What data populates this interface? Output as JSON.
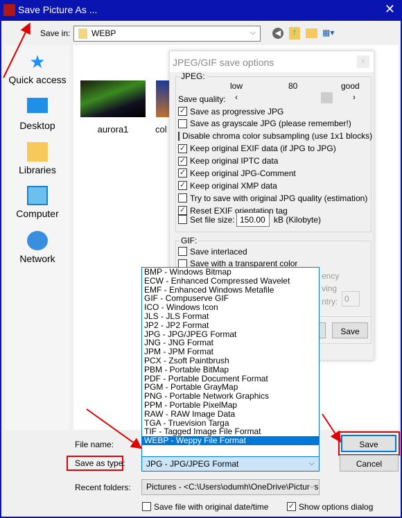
{
  "window": {
    "title": "Save Picture As ...",
    "close": "✕"
  },
  "toolbar": {
    "save_in_label": "Save in:",
    "folder": "WEBP"
  },
  "places": [
    {
      "label": "Quick access"
    },
    {
      "label": "Desktop"
    },
    {
      "label": "Libraries"
    },
    {
      "label": "Computer"
    },
    {
      "label": "Network"
    }
  ],
  "files": [
    {
      "name": "aurora1"
    },
    {
      "name": "col"
    }
  ],
  "options": {
    "title": "JPEG/GIF save options",
    "close": "x",
    "jpeg_label": "JPEG:",
    "low": "low",
    "quality": "80",
    "good": "good",
    "quality_label": "Save quality:",
    "checks": [
      {
        "label": "Save as progressive JPG",
        "checked": true
      },
      {
        "label": "Save as grayscale JPG (please remember!)",
        "checked": false
      },
      {
        "label": "Disable chroma color subsampling (use 1x1 blocks)",
        "checked": false
      },
      {
        "label": "Keep original EXIF data (if JPG to JPG)",
        "checked": true
      },
      {
        "label": "Keep original IPTC data",
        "checked": true
      },
      {
        "label": "Keep original JPG-Comment",
        "checked": true
      },
      {
        "label": "Keep original XMP data",
        "checked": true
      },
      {
        "label": "Try to save with original JPG quality (estimation)",
        "checked": false
      },
      {
        "label": "Reset EXIF orientation tag",
        "checked": true
      }
    ],
    "file_size_label": "Set file size:",
    "file_size": "150.00",
    "file_size_unit": "kB (Kilobyte)",
    "gif_label": "GIF:",
    "gif_checks": [
      {
        "label": "Save interlaced",
        "checked": false
      },
      {
        "label": "Save with a transparent color",
        "checked": false
      }
    ],
    "partial1": "ency",
    "partial2": "ving",
    "partial3": "ntry:",
    "entry_value": "0",
    "save": "Save"
  },
  "types": [
    "BMP - Windows Bitmap",
    "ECW - Enhanced Compressed Wavelet",
    "EMF - Enhanced Windows Metafile",
    "GIF - Compuserve GIF",
    "ICO - Windows Icon",
    "JLS - JLS Format",
    "JP2 - JP2 Format",
    "JPG - JPG/JPEG Format",
    "JNG - JNG Format",
    "JPM - JPM Format",
    "PCX - Zsoft Paintbrush",
    "PBM - Portable BitMap",
    "PDF - Portable Document Format",
    "PGM - Portable GrayMap",
    "PNG - Portable Network Graphics",
    "PPM - Portable PixelMap",
    "RAW - RAW Image Data",
    "TGA - Truevision Targa",
    "TIF - Tagged Image File Format",
    "WEBP - Weppy File Format"
  ],
  "selected_type_index": 19,
  "bottom": {
    "file_name_label": "File name:",
    "save_as_type_label": "Save as type:",
    "save_as_type": "JPG - JPG/JPEG Format",
    "recent_label": "Recent folders:",
    "recent": "Pictures  -  <C:\\Users\\odumh\\OneDrive\\Pictures",
    "save": "Save",
    "cancel": "Cancel",
    "orig_date": "Save file with original date/time",
    "orig_date_checked": false,
    "show_opts": "Show options dialog",
    "show_opts_checked": true
  },
  "colors": {
    "titlebar": "#0a14b0",
    "highlight": "#0078d7",
    "annotation": "#e00000"
  }
}
